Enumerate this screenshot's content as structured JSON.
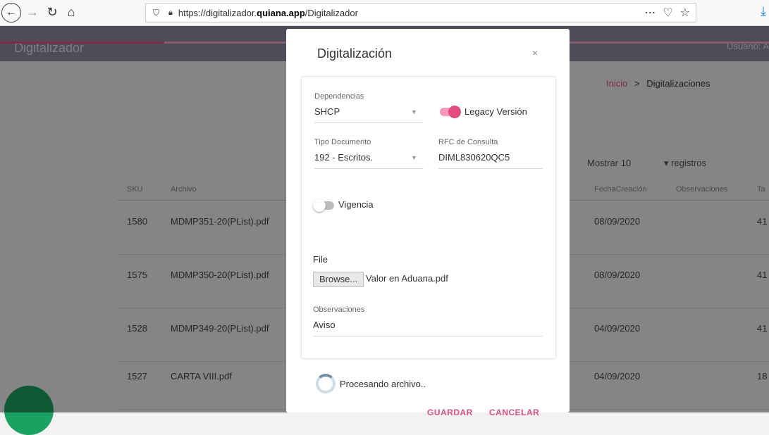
{
  "browser": {
    "url_prefix": "https://digitalizador.",
    "url_domain": "quiana.app",
    "url_path": "/Digitalizador"
  },
  "app": {
    "title": "Digitalizador",
    "user": "Usuario: A",
    "breadcrumb": {
      "home": "Inicio",
      "separator": ">",
      "current": "Digitalizaciones"
    },
    "mostrar_label": "Mostrar",
    "mostrar_value": "10",
    "registros_label": "registros",
    "table": {
      "headers": [
        "SKU",
        "Archivo",
        "FechaCreación",
        "Observaciones",
        "Ta"
      ],
      "rows": [
        {
          "sku": "1580",
          "archivo": "MDMP351-20(PList).pdf",
          "fecha": "08/09/2020",
          "tail": "41"
        },
        {
          "sku": "1575",
          "archivo": "MDMP350-20(PList).pdf",
          "fecha": "08/09/2020",
          "tail": "41"
        },
        {
          "sku": "1528",
          "archivo": "MDMP349-20(PList).pdf",
          "fecha": "04/09/2020",
          "tail": "41"
        },
        {
          "sku": "1527",
          "archivo": "CARTA VIII.pdf",
          "fecha": "04/09/2020",
          "tail": "18"
        }
      ]
    }
  },
  "modal": {
    "title": "Digitalización",
    "close": "×",
    "dependencias_label": "Dependencias",
    "dependencias_value": "SHCP",
    "legacy_label": "Legacy Versión",
    "legacy_on": true,
    "tipo_label": "Tipo Documento",
    "tipo_value": "192 - Escritos.",
    "rfc_label": "RFC de Consulta",
    "rfc_value": "DIML830620QC5",
    "vigencia_label": "Vigencia",
    "vigencia_on": false,
    "file_label": "File",
    "browse_label": "Browse...",
    "file_name": "Valor en Aduana.pdf",
    "observaciones_label": "Observaciones",
    "observaciones_value": "Aviso",
    "processing": "Procesando archivo..",
    "guardar": "GUARDAR",
    "cancelar": "CANCELAR"
  },
  "colors": {
    "accent": "#e34d80",
    "header": "#8e8ba3",
    "fab": "#1aa260"
  },
  "icons": [
    "back-icon",
    "forward-icon",
    "reload-icon",
    "home-icon",
    "shield-icon",
    "lock-icon",
    "more-icon",
    "pocket-icon",
    "star-icon",
    "download-icon",
    "caret-down-icon",
    "spinner-icon"
  ]
}
